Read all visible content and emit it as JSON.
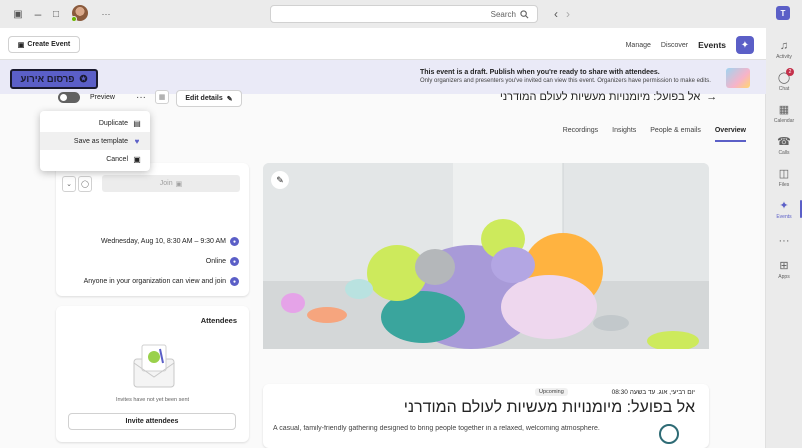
{
  "titlebar": {
    "search_placeholder": "Search",
    "more": "···",
    "back": "‹",
    "forward": "›"
  },
  "rail": {
    "items": [
      {
        "label": "Activity",
        "icon": "bell-icon"
      },
      {
        "label": "Chat",
        "icon": "chat-icon",
        "badge": "2"
      },
      {
        "label": "Calendar",
        "icon": "calendar-icon"
      },
      {
        "label": "Calls",
        "icon": "phone-icon"
      },
      {
        "label": "Files",
        "icon": "file-icon"
      },
      {
        "label": "Events",
        "icon": "events-icon",
        "active": true
      },
      {
        "label": "",
        "icon": "more-icon"
      },
      {
        "label": "Apps",
        "icon": "apps-icon"
      }
    ]
  },
  "header": {
    "create_label": "Create Event",
    "app_title": "Events",
    "tabs": [
      "Discover",
      "Manage"
    ]
  },
  "banner": {
    "title": "This event is a draft. Publish when you're ready to share with attendees.",
    "subtitle": "Only organizers and presenters you've invited can view this event. Organizers have permission to make edits.",
    "publish_label": "פרסום אירוע"
  },
  "event": {
    "title": "אל בפועל: מיומנויות מעשיות לעולם המודרני",
    "edit_label": "Edit details",
    "preview_label": "Preview",
    "tabs": [
      "Overview",
      "People & emails",
      "Insights",
      "Recordings"
    ]
  },
  "menu": {
    "items": [
      "Duplicate",
      "Save as template",
      "Cancel"
    ]
  },
  "join_card": {
    "join_label": "Join",
    "datetime": "Wednesday, Aug 10, 8:30 AM – 9:30 AM",
    "location": "Online",
    "access": "Anyone in your organization can view and join"
  },
  "attendees": {
    "title": "Attendees",
    "empty_text": "Invites have not yet been sent",
    "invite_label": "Invite attendees"
  },
  "details": {
    "date": "יום רביעי, אוג. עד בשעה 08:30",
    "badge": "Upcoming",
    "title": "אל בפועל: מיומנויות מעשיות לעולם המודרני",
    "description": "A casual, family-friendly gathering designed to bring people together in a relaxed, welcoming atmosphere."
  },
  "colors": {
    "accent": "#5b5fc7",
    "badge_red": "#c4314b",
    "presence_green": "#6bb700"
  }
}
